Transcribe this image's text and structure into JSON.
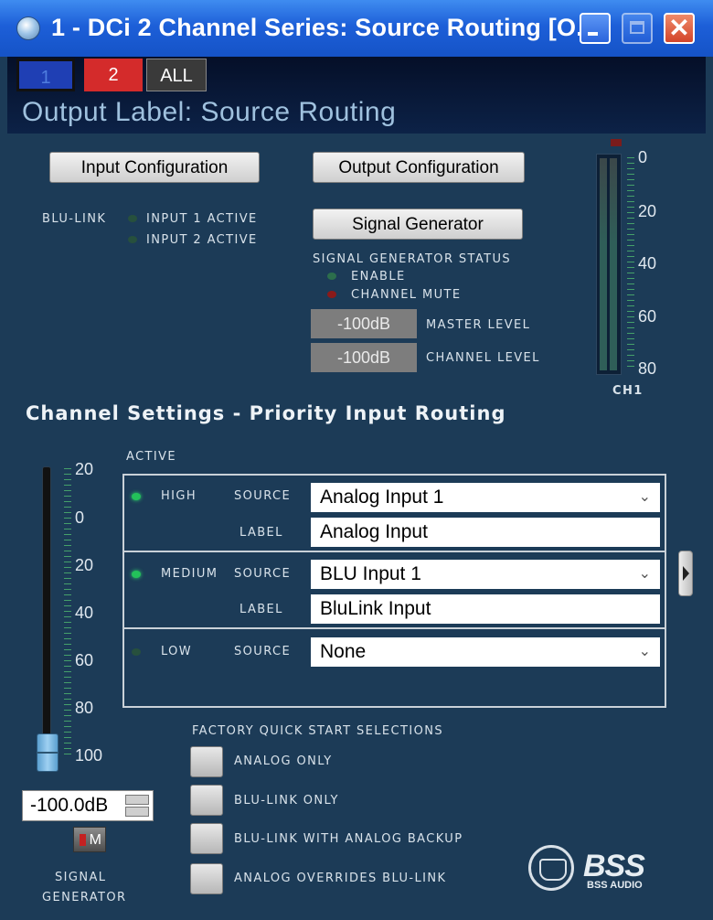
{
  "window": {
    "title": "1 - DCi 2 Channel Series: Source Routing [O...",
    "controls": {
      "minimize_icon": "minimize-icon",
      "maximize_icon": "maximize-icon",
      "close_icon": "close-icon",
      "close_glyph": "✕"
    }
  },
  "channel_tabs": [
    "1",
    "2",
    "ALL"
  ],
  "output_label": "Output Label: Source Routing",
  "buttons": {
    "input_configuration": "Input Configuration",
    "output_configuration": "Output Configuration",
    "signal_generator": "Signal Generator"
  },
  "blu_link": {
    "label": "BLU-LINK",
    "input1": "INPUT 1 ACTIVE",
    "input2": "INPUT 2 ACTIVE"
  },
  "signal_generator_status": {
    "title": "SIGNAL GENERATOR STATUS",
    "enable": "ENABLE",
    "channel_mute": "CHANNEL MUTE",
    "master_level_value": "-100dB",
    "master_level_label": "MASTER LEVEL",
    "channel_level_value": "-100dB",
    "channel_level_label": "CHANNEL LEVEL"
  },
  "meter": {
    "scale": [
      "0",
      "20",
      "40",
      "60",
      "80"
    ],
    "channel": "CH1"
  },
  "channel_settings_title": "Channel Settings - Priority Input Routing",
  "fader": {
    "scale": [
      "20",
      "0",
      "20",
      "40",
      "60",
      "80",
      "100"
    ],
    "level": "-100.0dB"
  },
  "routing": {
    "active_label": "ACTIVE",
    "source_label": "SOURCE",
    "label_label": "LABEL",
    "rows": [
      {
        "priority": "HIGH",
        "source": "Analog Input 1",
        "label": "Analog Input",
        "active": true
      },
      {
        "priority": "MEDIUM",
        "source": "BLU Input 1",
        "label": "BluLink Input",
        "active": true
      },
      {
        "priority": "LOW",
        "source": "None",
        "label": "",
        "active": false
      }
    ]
  },
  "factory": {
    "title": "FACTORY QUICK START SELECTIONS",
    "options": [
      "ANALOG ONLY",
      "BLU-LINK ONLY",
      "BLU-LINK WITH ANALOG BACKUP",
      "ANALOG OVERRIDES BLU-LINK"
    ]
  },
  "signal_generator_mute": {
    "button": "M",
    "label_line1": "SIGNAL",
    "label_line2": "GENERATOR"
  },
  "logo": {
    "mark": "BSS",
    "name": "BSS AUDIO"
  },
  "colors": {
    "panel": "#1c3b57",
    "titlebar": "#1d5fd8",
    "active_led": "#23c15a",
    "mute_led": "#8a1a1a"
  }
}
